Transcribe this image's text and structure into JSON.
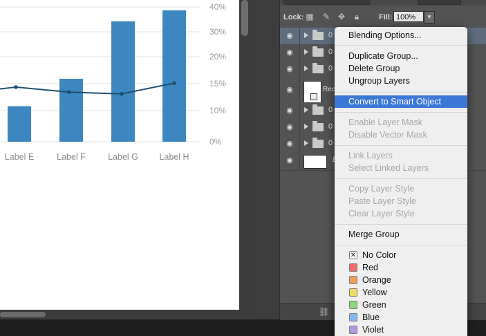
{
  "chart_data": {
    "type": "bar",
    "categories": [
      "Label E",
      "Label F",
      "Label G",
      "Label H"
    ],
    "bar_values": [
      13,
      23,
      44,
      48
    ],
    "bar_ylim": [
      0,
      48
    ],
    "line_values": [
      16.2,
      14.7,
      14.2,
      17.4
    ],
    "y_ticks": [
      "40%",
      "30%",
      "20%",
      "15%",
      "10%",
      "0%"
    ],
    "bar_color": "#3d87c0",
    "line_color": "#1f4f6e",
    "grid": true
  },
  "layers_panel": {
    "lock_label": "Lock:",
    "fill_label": "Fill:",
    "fill_value": "100%",
    "rows": [
      {
        "name": "0"
      },
      {
        "name": "0"
      },
      {
        "name": "0"
      },
      {
        "name": "Rec"
      },
      {
        "name": "0"
      },
      {
        "name": "0"
      },
      {
        "name": "0"
      },
      {
        "name": "B"
      }
    ]
  },
  "context_menu": {
    "blending_options": "Blending Options...",
    "duplicate_group": "Duplicate Group...",
    "delete_group": "Delete Group",
    "ungroup_layers": "Ungroup Layers",
    "convert_smart_object": "Convert to Smart Object",
    "enable_layer_mask": "Enable Layer Mask",
    "disable_vector_mask": "Disable Vector Mask",
    "link_layers": "Link Layers",
    "select_linked_layers": "Select Linked Layers",
    "copy_layer_style": "Copy Layer Style",
    "paste_layer_style": "Paste Layer Style",
    "clear_layer_style": "Clear Layer Style",
    "merge_group": "Merge Group",
    "colors": [
      {
        "label": "No Color",
        "color": "none"
      },
      {
        "label": "Red",
        "color": "#f26c6c"
      },
      {
        "label": "Orange",
        "color": "#f5a05a"
      },
      {
        "label": "Yellow",
        "color": "#eddc62"
      },
      {
        "label": "Green",
        "color": "#92d67c"
      },
      {
        "label": "Blue",
        "color": "#86b8f0"
      },
      {
        "label": "Violet",
        "color": "#b09be0"
      }
    ]
  }
}
